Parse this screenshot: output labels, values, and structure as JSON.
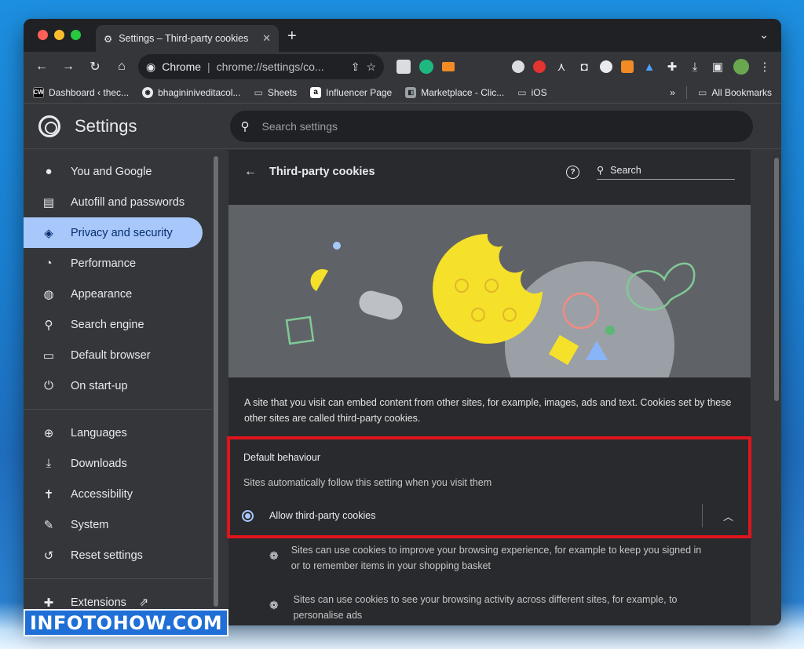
{
  "tab": {
    "title": "Settings – Third-party cookies",
    "close": "✕"
  },
  "toolbar": {
    "origin": "Chrome",
    "separator": "|",
    "url": "chrome://settings/co...",
    "new_tab": "+",
    "tab_menu": "⌄"
  },
  "bookmarks": [
    {
      "label": "Dashboard ‹ thec...",
      "icon": "CW",
      "color": "#000000"
    },
    {
      "label": "bhagininiveditacol...",
      "icon": "◉",
      "color": "#202124"
    },
    {
      "label": "Sheets",
      "icon": "folder",
      "color": "#bdc1c6"
    },
    {
      "label": "Influencer Page",
      "icon": "a",
      "color": "#ffffff"
    },
    {
      "label": "Marketplace - Clic...",
      "icon": "◧",
      "color": "#9aa0a6"
    },
    {
      "label": "iOS",
      "icon": "folder",
      "color": "#bdc1c6"
    }
  ],
  "bookmarks_more": "»",
  "bookmarks_all": "All Bookmarks",
  "header": {
    "title": "Settings",
    "search_placeholder": "Search settings"
  },
  "sidebar": {
    "items": [
      {
        "label": "You and Google",
        "icon": "person-icon"
      },
      {
        "label": "Autofill and passwords",
        "icon": "clipboard-icon"
      },
      {
        "label": "Privacy and security",
        "icon": "shield-icon",
        "active": true
      },
      {
        "label": "Performance",
        "icon": "speedometer-icon"
      },
      {
        "label": "Appearance",
        "icon": "palette-icon"
      },
      {
        "label": "Search engine",
        "icon": "search-icon"
      },
      {
        "label": "Default browser",
        "icon": "browser-icon"
      },
      {
        "label": "On start-up",
        "icon": "power-icon"
      }
    ],
    "items2": [
      {
        "label": "Languages",
        "icon": "globe-icon"
      },
      {
        "label": "Downloads",
        "icon": "download-icon"
      },
      {
        "label": "Accessibility",
        "icon": "accessibility-icon"
      },
      {
        "label": "System",
        "icon": "wrench-icon"
      },
      {
        "label": "Reset settings",
        "icon": "history-icon"
      }
    ],
    "extensions": {
      "label": "Extensions",
      "icon": "puzzle-icon"
    }
  },
  "card": {
    "title": "Third-party cookies",
    "search_label": "Search",
    "description": "A site that you visit can embed content from other sites, for example, images, ads and text. Cookies set by these other sites are called third-party cookies.",
    "default_behaviour_title": "Default behaviour",
    "default_behaviour_sub": "Sites automatically follow this setting when you visit them",
    "radio_label": "Allow third-party cookies",
    "sub_items": [
      "Sites can use cookies to improve your browsing experience, for example to keep you signed in or to remember items in your shopping basket",
      "Sites can use cookies to see your browsing activity across different sites, for example, to personalise ads"
    ]
  },
  "watermark": "INFOTOHOW.COM",
  "colors": {
    "accent": "#a8c7fa",
    "highlight_border": "#e0141b",
    "cookie_yellow": "#f5e12a"
  }
}
